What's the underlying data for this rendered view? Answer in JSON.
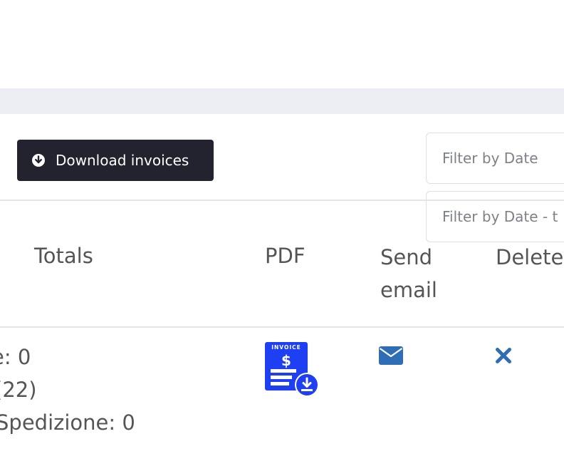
{
  "toolbar": {
    "download_label": "Download invoices",
    "filter_date_placeholder": "Filter by Date",
    "filter_date_to_placeholder": "Filter by Date - t"
  },
  "table": {
    "headers": {
      "totals": "Totals",
      "pdf": "PDF",
      "send_email_line1": "Send",
      "send_email_line2": "email",
      "delete": "Delete"
    },
    "rows": [
      {
        "totals_lines": [
          "e: 0",
          "(22)",
          "Spedizione: 0",
          ")"
        ],
        "pdf_icon_text": "INVOICE"
      }
    ]
  },
  "colors": {
    "button_bg": "#22232e",
    "icon_blue": "#2f6db5",
    "invoice_blue": "#1f3ff2",
    "gray_band": "#eceef3"
  },
  "icons": {
    "download": "download-circle-icon",
    "pdf": "invoice-download-icon",
    "mail": "envelope-icon",
    "delete": "close-x-icon"
  }
}
